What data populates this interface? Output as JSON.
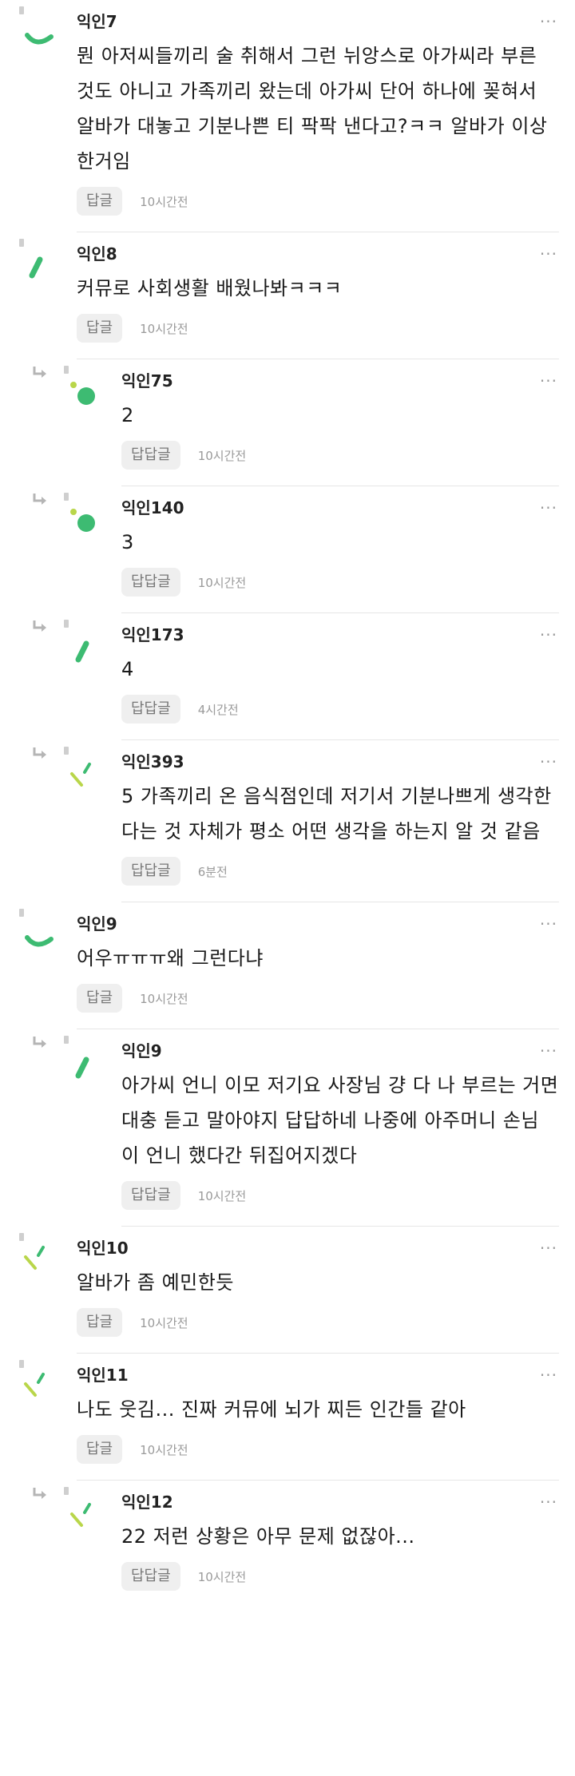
{
  "more_label": "···",
  "colors": {
    "green": "#3dbb72",
    "lime": "#b9d64a",
    "separator": "#e6e6e6"
  },
  "comments": [
    {
      "type": "top",
      "name": "익인7",
      "avatar": "green-arc",
      "lines": [
        "뭔 아저씨들끼리 술 취해서 그런 뉘앙스로 아가씨라 부른",
        "것도 아니고 가족끼리 왔는데 아가씨 단어 하나에 꽂혀서",
        "알바가 대놓고 기분나쁜 티 팍팍 낸다고?ㅋㅋ 알바가 이상",
        "한거임"
      ],
      "reply_label": "답글",
      "time": "10시간전"
    },
    {
      "type": "top",
      "name": "익인8",
      "avatar": "green-dash",
      "lines": [
        "커뮤로 사회생활 배웠나봐ㅋㅋㅋ"
      ],
      "reply_label": "답글",
      "time": "10시간전"
    },
    {
      "type": "reply",
      "name": "익인75",
      "avatar": "green-dots",
      "lines": [
        "2"
      ],
      "reply_label": "답답글",
      "time": "10시간전"
    },
    {
      "type": "reply",
      "name": "익인140",
      "avatar": "green-dots",
      "lines": [
        "3"
      ],
      "reply_label": "답답글",
      "time": "10시간전"
    },
    {
      "type": "reply",
      "name": "익인173",
      "avatar": "green-dash",
      "lines": [
        "4"
      ],
      "reply_label": "답답글",
      "time": "4시간전"
    },
    {
      "type": "reply",
      "name": "익인393",
      "avatar": "lime-strokes",
      "lines": [
        "5 가족끼리 온 음식점인데 저기서 기분나쁘게 생각한",
        "다는 것 자체가 평소 어떤 생각을 하는지 알 것 같음"
      ],
      "reply_label": "답답글",
      "time": "6분전"
    },
    {
      "type": "top",
      "name": "익인9",
      "avatar": "green-arc",
      "lines": [
        "어우ㅠㅠㅠ왜 그런다냐"
      ],
      "reply_label": "답글",
      "time": "10시간전"
    },
    {
      "type": "reply",
      "name": "익인9",
      "avatar": "green-dash",
      "lines": [
        "아가씨 언니 이모 저기요 사장님 걍 다 나 부르는 거면",
        "대충 듣고 말아야지 답답하네 나중에 아주머니 손님",
        "이 언니 했다간 뒤집어지겠다"
      ],
      "reply_label": "답답글",
      "time": "10시간전"
    },
    {
      "type": "top",
      "name": "익인10",
      "avatar": "lime-strokes",
      "lines": [
        "알바가 좀 예민한듯"
      ],
      "reply_label": "답글",
      "time": "10시간전"
    },
    {
      "type": "top",
      "name": "익인11",
      "avatar": "lime-strokes",
      "lines": [
        "나도 웃김... 진짜 커뮤에 뇌가 찌든 인간들 같아"
      ],
      "reply_label": "답글",
      "time": "10시간전"
    },
    {
      "type": "reply",
      "name": "익인12",
      "avatar": "lime-strokes",
      "lines": [
        "22 저런 상황은 아무 문제 없잖아..."
      ],
      "reply_label": "답답글",
      "time": "10시간전"
    }
  ]
}
